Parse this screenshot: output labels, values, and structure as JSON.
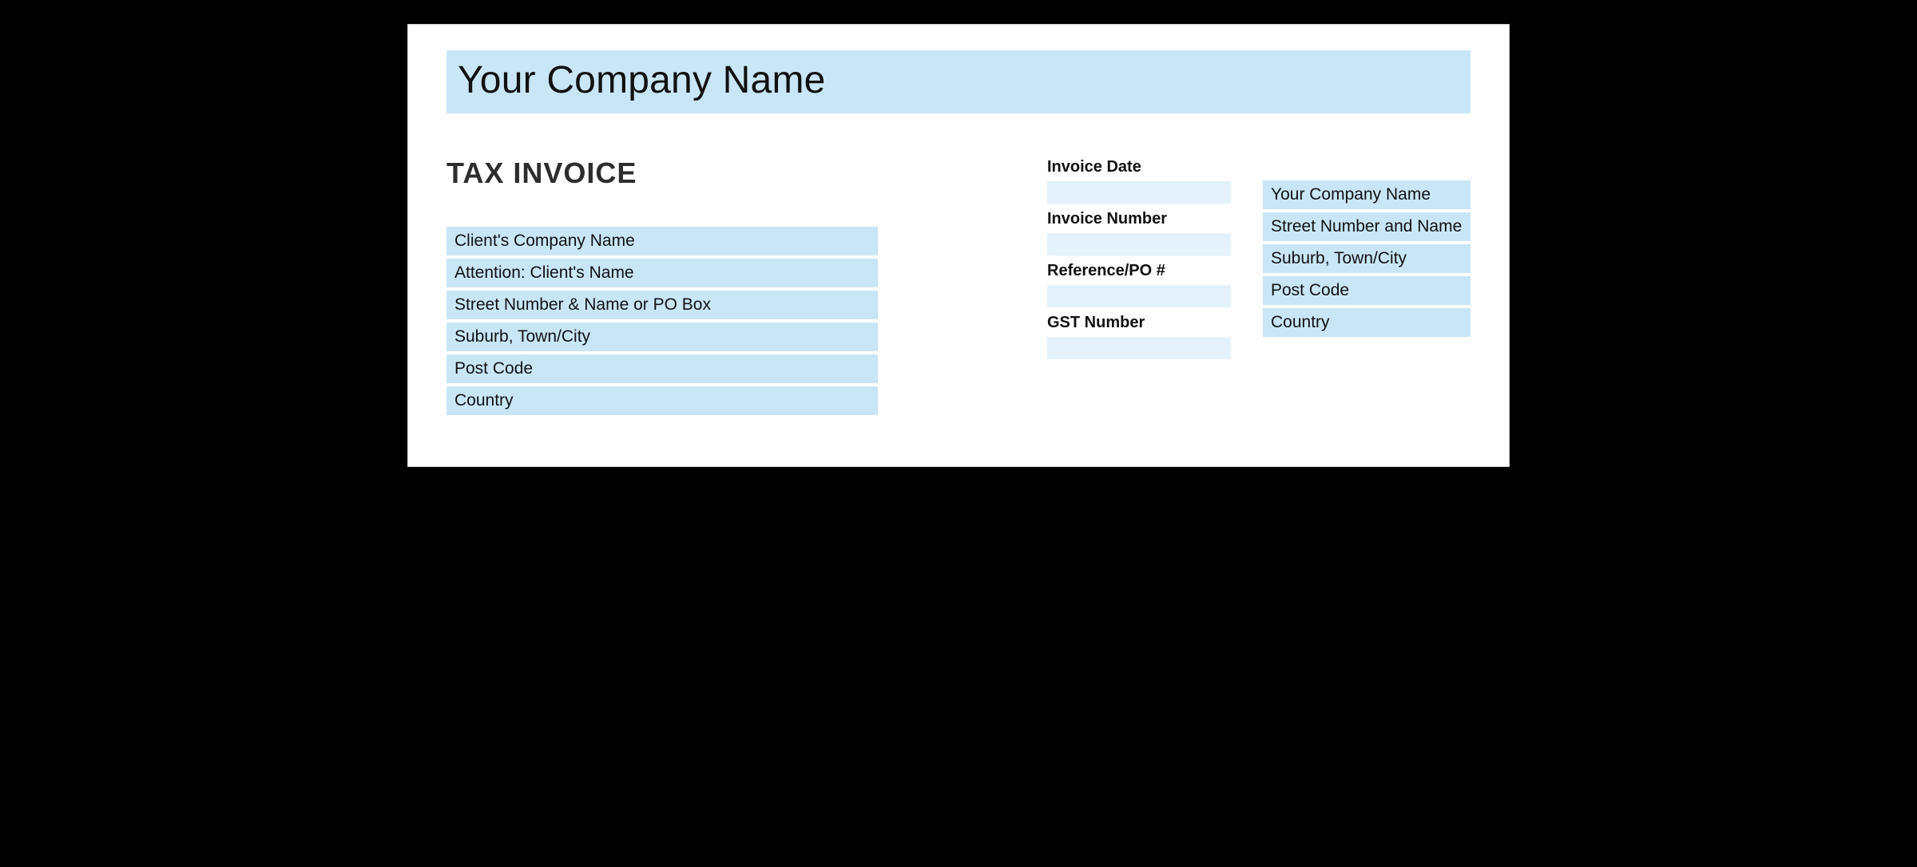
{
  "header": {
    "company_name": "Your Company Name"
  },
  "title": "TAX INVOICE",
  "client_fields": [
    "Client's Company Name",
    "Attention: Client's Name",
    "Street Number & Name or PO Box",
    "Suburb, Town/City",
    "Post Code",
    "Country"
  ],
  "meta": {
    "invoice_date": {
      "label": "Invoice Date",
      "value": ""
    },
    "invoice_number": {
      "label": "Invoice Number",
      "value": ""
    },
    "reference_po": {
      "label": "Reference/PO #",
      "value": ""
    },
    "gst_number": {
      "label": "GST Number",
      "value": ""
    }
  },
  "company_address_fields": [
    "Your Company Name",
    "Street Number and Name",
    "Suburb, Town/City",
    "Post Code",
    "Country"
  ]
}
